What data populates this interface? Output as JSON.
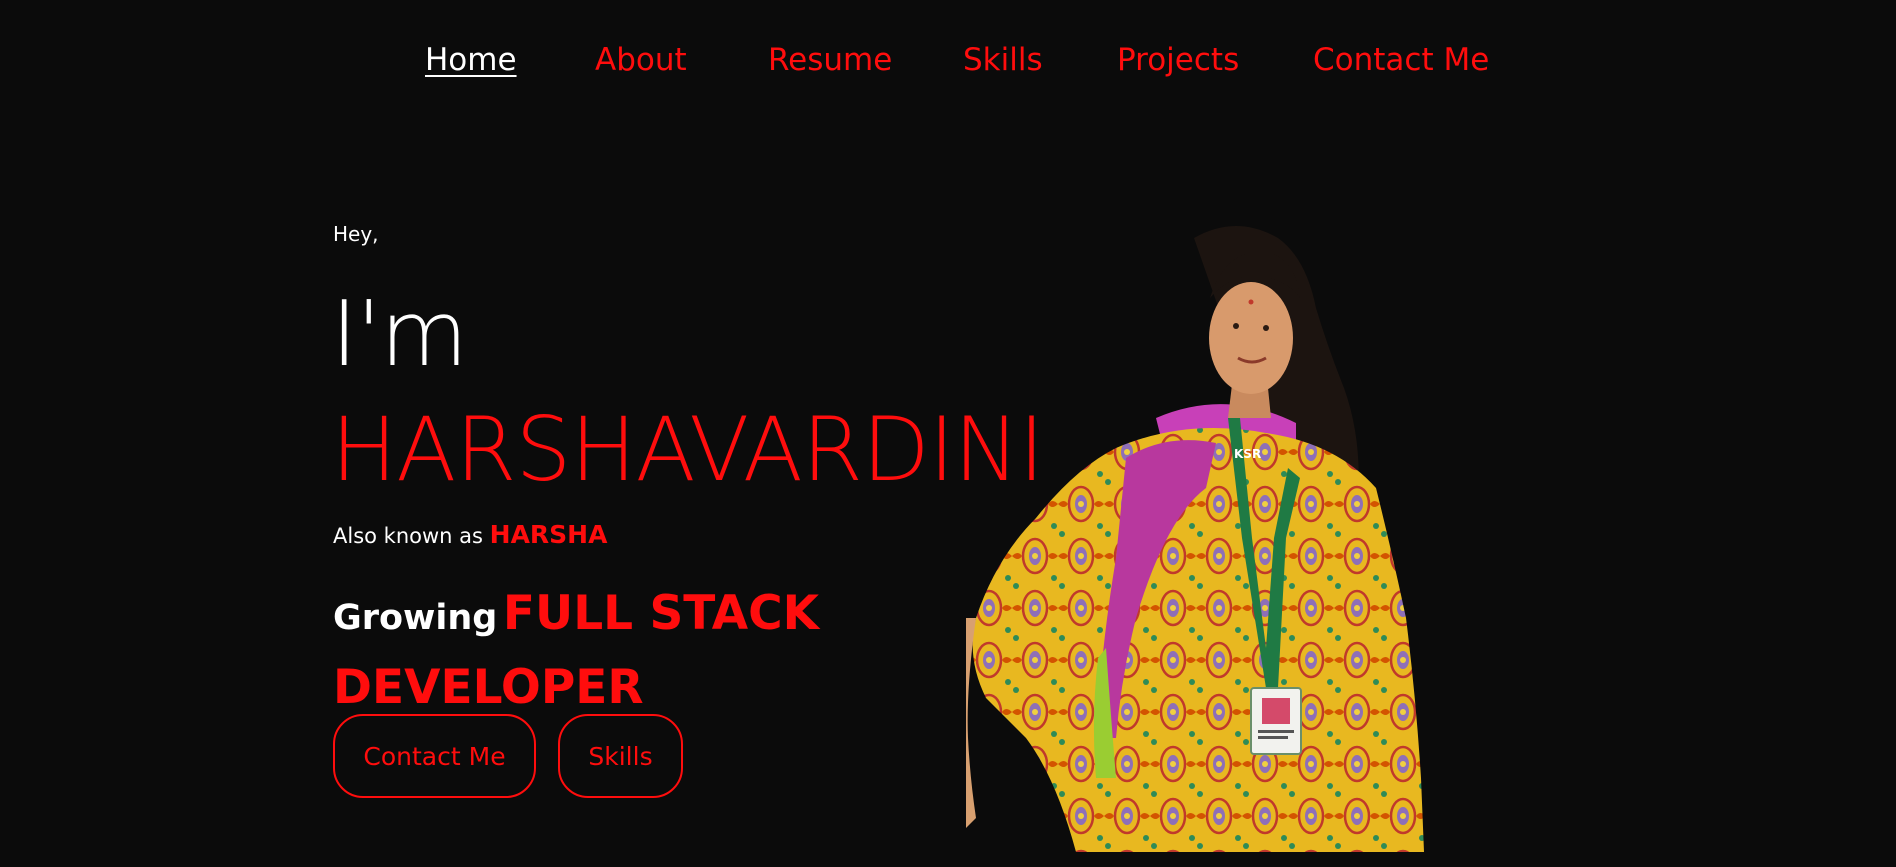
{
  "nav": {
    "items": [
      {
        "label": "Home",
        "active": true
      },
      {
        "label": "About",
        "active": false
      },
      {
        "label": "Resume",
        "active": false
      },
      {
        "label": "Skills",
        "active": false
      },
      {
        "label": "Projects",
        "active": false
      },
      {
        "label": "Contact Me",
        "active": false
      }
    ]
  },
  "hero": {
    "greeting": "Hey,",
    "intro": "I'm",
    "name": "HARSHAVARDINI",
    "aka_prefix": "Also known as",
    "nickname": "HARSHA",
    "role_prefix": "Growing",
    "role_title": "FULL STACK DEVELOPER"
  },
  "buttons": {
    "contact": "Contact Me",
    "skills": "Skills"
  },
  "portrait": {
    "id_card_text": "KSR"
  },
  "colors": {
    "background": "#0b0b0b",
    "accent": "#ff0d0d",
    "text": "#ffffff"
  }
}
